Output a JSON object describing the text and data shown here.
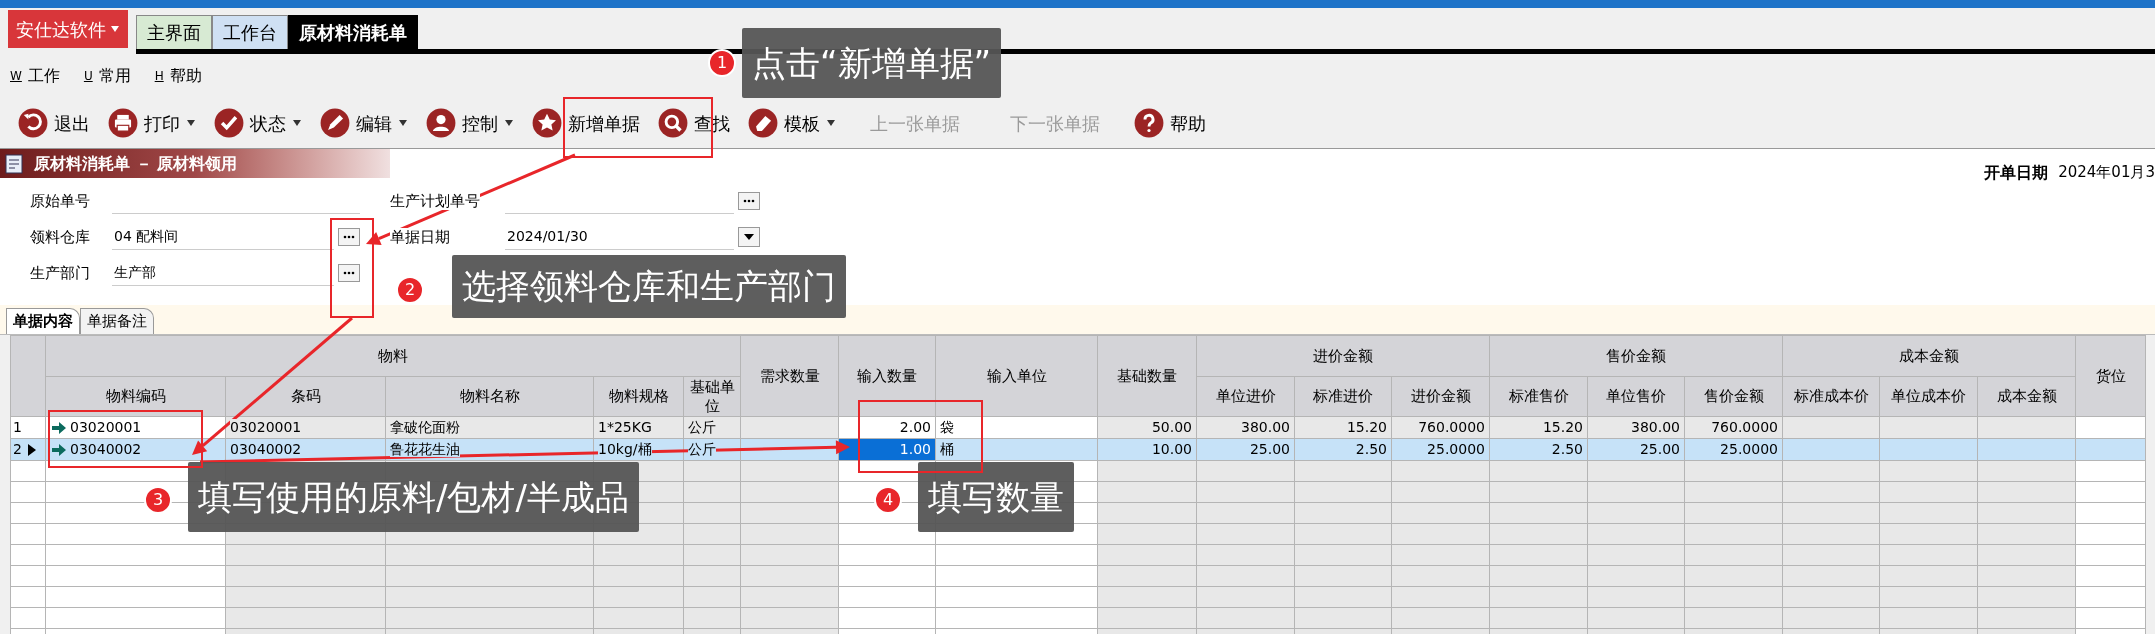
{
  "app_button": {
    "label": "安仕达软件"
  },
  "tabs": [
    {
      "label": "主界面",
      "selected": false,
      "color": "#d7ead3"
    },
    {
      "label": "工作台",
      "selected": false,
      "color": "#cfe0f3"
    },
    {
      "label": "原材料消耗单",
      "selected": true,
      "color": "#000000"
    }
  ],
  "menu": [
    {
      "key": "W",
      "label": "工作"
    },
    {
      "key": "U",
      "label": "常用"
    },
    {
      "key": "H",
      "label": "帮助"
    }
  ],
  "toolbar": [
    {
      "label": "退出",
      "dropdown": false,
      "disabled": false
    },
    {
      "label": "打印",
      "dropdown": true,
      "disabled": false
    },
    {
      "label": "状态",
      "dropdown": true,
      "disabled": false
    },
    {
      "label": "编辑",
      "dropdown": true,
      "disabled": false
    },
    {
      "label": "控制",
      "dropdown": true,
      "disabled": false
    },
    {
      "label": "新增单据",
      "dropdown": false,
      "disabled": false
    },
    {
      "label": "查找",
      "dropdown": false,
      "disabled": false
    },
    {
      "label": "模板",
      "dropdown": true,
      "disabled": false
    },
    {
      "label": "上一张单据",
      "dropdown": false,
      "disabled": true
    },
    {
      "label": "下一张单据",
      "dropdown": false,
      "disabled": true
    },
    {
      "label": "帮助",
      "dropdown": false,
      "disabled": false
    }
  ],
  "section_title": "原材料消耗单 － 原材料领用",
  "open_date": {
    "label": "开单日期",
    "value": "2024年01月3"
  },
  "form_left": [
    {
      "label": "原始单号",
      "kind": "plain"
    },
    {
      "label": "领料仓库",
      "value": "04 配料间",
      "kind": "lookup"
    },
    {
      "label": "生产部门",
      "value": "生产部",
      "kind": "lookup"
    }
  ],
  "form_right": [
    {
      "label": "生产计划单号",
      "kind": "lookup"
    },
    {
      "label": "单据日期",
      "value": "2024/01/30",
      "kind": "dropdown"
    }
  ],
  "inner_tabs": [
    {
      "label": "单据内容",
      "selected": true
    },
    {
      "label": "单据备注",
      "selected": false
    }
  ],
  "table": {
    "groups": [
      {
        "label": "物料",
        "columns": [
          {
            "label": "物料编码",
            "editable": true
          },
          {
            "label": "条码",
            "editable": false
          },
          {
            "label": "物料名称",
            "editable": false
          },
          {
            "label": "物料规格",
            "editable": false
          },
          {
            "label": "基础单位",
            "editable": false
          }
        ]
      },
      {
        "columns": [
          {
            "label": "需求数量",
            "editable": false
          }
        ]
      },
      {
        "columns": [
          {
            "label": "输入数量",
            "editable": true
          }
        ]
      },
      {
        "columns": [
          {
            "label": "输入单位",
            "editable": true
          }
        ]
      },
      {
        "columns": [
          {
            "label": "基础数量",
            "editable": false
          }
        ]
      },
      {
        "label": "进价金额",
        "columns": [
          {
            "label": "单位进价",
            "editable": false
          },
          {
            "label": "标准进价",
            "editable": false
          },
          {
            "label": "进价金额",
            "editable": false
          }
        ]
      },
      {
        "label": "售价金额",
        "columns": [
          {
            "label": "标准售价",
            "editable": false
          },
          {
            "label": "单位售价",
            "editable": false
          },
          {
            "label": "售价金额",
            "editable": false
          }
        ]
      },
      {
        "label": "成本金额",
        "columns": [
          {
            "label": "标准成本价",
            "editable": false
          },
          {
            "label": "单位成本价",
            "editable": false
          },
          {
            "label": "成本金额",
            "editable": false
          }
        ]
      },
      {
        "columns": [
          {
            "label": "货位",
            "editable": true
          }
        ]
      }
    ],
    "rows": [
      {
        "number": "1",
        "selected": false,
        "input_focused": false,
        "cells": [
          "03020001",
          "03020001",
          "拿破伦面粉",
          "1*25KG",
          "公斤",
          "",
          "2.00",
          "袋",
          "50.00",
          "380.00",
          "15.20",
          "760.0000",
          "15.20",
          "380.00",
          "760.0000",
          "",
          "",
          "",
          ""
        ]
      },
      {
        "number": "2",
        "selected": true,
        "input_focused": true,
        "cells": [
          "03040002",
          "03040002",
          "鲁花花生油",
          "10kg/桶",
          "公斤",
          "",
          "1.00",
          "桶",
          "10.00",
          "25.00",
          "2.50",
          "25.0000",
          "2.50",
          "25.00",
          "25.0000",
          "",
          "",
          "",
          ""
        ]
      }
    ]
  },
  "annotations": [
    {
      "number": "1",
      "text": "点击“新增单据”"
    },
    {
      "number": "2",
      "text": "选择领料仓库和生产部门"
    },
    {
      "number": "3",
      "text": "填写使用的原料/包材/半成品"
    },
    {
      "number": "4",
      "text": "填写数量"
    }
  ]
}
